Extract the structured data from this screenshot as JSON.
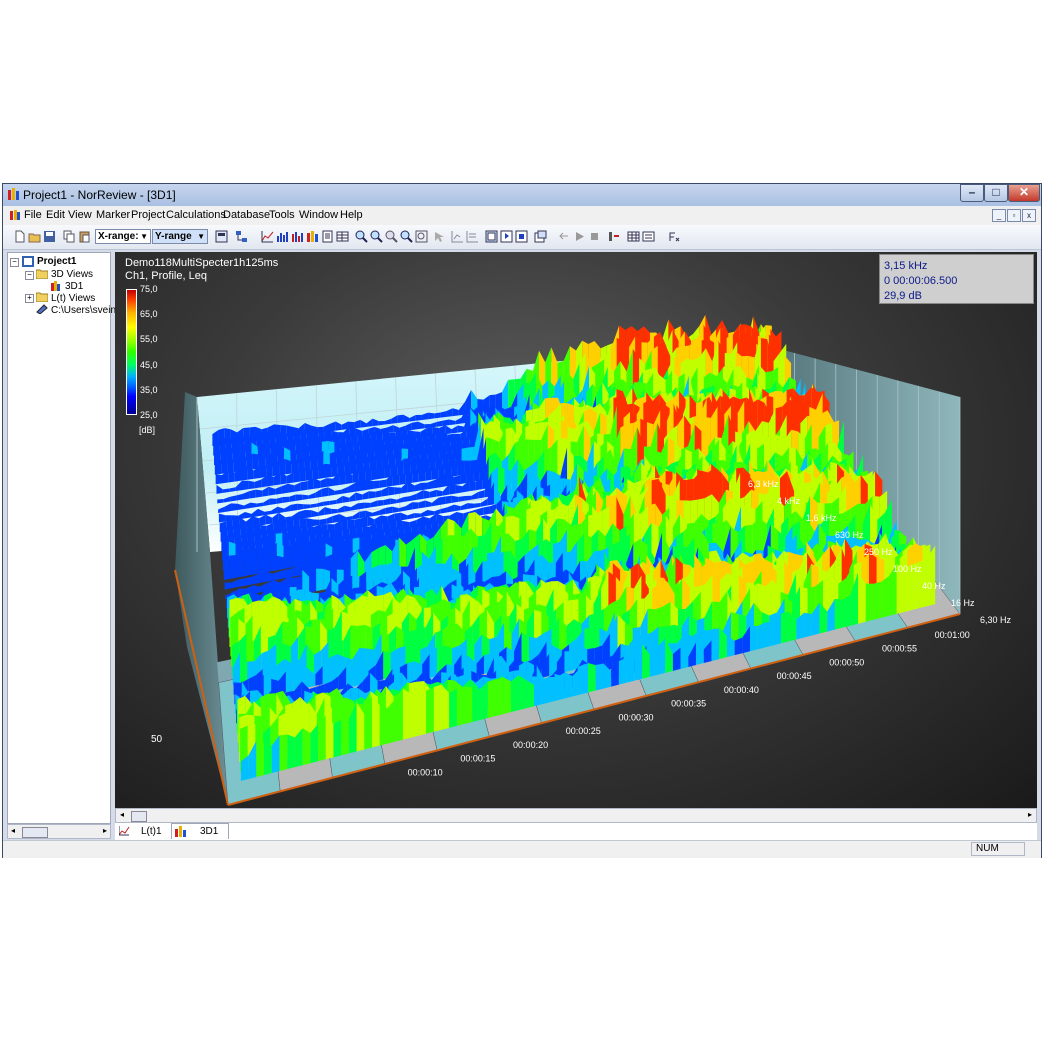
{
  "window": {
    "title": "Project1 - NorReview - [3D1]"
  },
  "menu": {
    "items": [
      "File",
      "Edit",
      "View",
      "Marker",
      "Project",
      "Calculations",
      "Database",
      "Tools",
      "Window",
      "Help"
    ]
  },
  "toolbar": {
    "xrange_label": "X-range:",
    "yrange_label": "Y-range"
  },
  "tree": {
    "root": "Project1",
    "views3d": "3D Views",
    "view3d1": "3D1",
    "ltviews": "L(t) Views",
    "path": "C:\\Users\\svein\\"
  },
  "chart": {
    "title_line1": "Demo118MultiSpecter1h125ms",
    "title_line2": "Ch1, Profile, Leq",
    "legend": {
      "ticks": [
        "75,0",
        "65,0",
        "55,0",
        "45,0",
        "35,0",
        "25,0"
      ],
      "unit": "[dB]"
    },
    "readout": {
      "freq": "3,15 kHz",
      "time": "0 00:00:06.500",
      "level": "29,9 dB"
    },
    "z_label": "50",
    "time_ticks": [
      "00:00:10",
      "00:00:15",
      "00:00:20",
      "00:00:25",
      "00:00:30",
      "00:00:35",
      "00:00:40",
      "00:00:45",
      "00:00:50",
      "00:00:55",
      "00:01:00"
    ],
    "freq_ticks": [
      "6,3 kHz",
      "4 kHz",
      "1,6 kHz",
      "630 Hz",
      "250 Hz",
      "100 Hz",
      "40 Hz",
      "16 Hz",
      "6,30 Hz"
    ]
  },
  "tabs": [
    "L(t)1",
    "3D1"
  ],
  "status": {
    "num": "NUM"
  },
  "colors": {
    "accent": "#0a1a8a",
    "chart_bg": "#2a2a2a"
  }
}
